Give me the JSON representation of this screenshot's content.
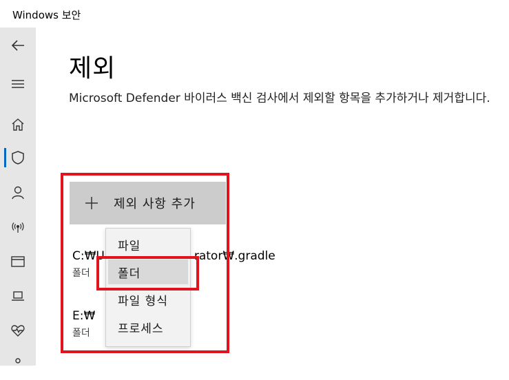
{
  "window": {
    "title": "Windows 보안"
  },
  "sidebar": {
    "items": [
      {
        "icon": "back-arrow-icon"
      },
      {
        "icon": "hamburger-menu-icon"
      },
      {
        "icon": "home-icon"
      },
      {
        "icon": "shield-icon",
        "active": true
      },
      {
        "icon": "person-icon"
      },
      {
        "icon": "wireless-icon"
      },
      {
        "icon": "app-browser-icon"
      },
      {
        "icon": "laptop-icon"
      },
      {
        "icon": "heart-pulse-icon"
      },
      {
        "icon": "family-icon"
      }
    ],
    "active_color": "#0067c0"
  },
  "page": {
    "title": "제외",
    "description": "Microsoft Defender 바이러스 백신 검사에서 제외할 항목을 추가하거나 제거합니다."
  },
  "add_button": {
    "label": "제외 사항 추가",
    "icon": "plus-icon"
  },
  "exclusions": [
    {
      "path_visible_start": "C:₩U",
      "path_visible_end": "rator₩.gradle",
      "type": "폴더"
    },
    {
      "path_visible_start": "E:₩",
      "path_visible_end": "",
      "type": "폴더"
    }
  ],
  "dropdown": {
    "options": [
      "파일",
      "폴더",
      "파일 형식",
      "프로세스"
    ],
    "hovered": "폴더"
  },
  "annotation": {
    "color": "#e1141e"
  }
}
